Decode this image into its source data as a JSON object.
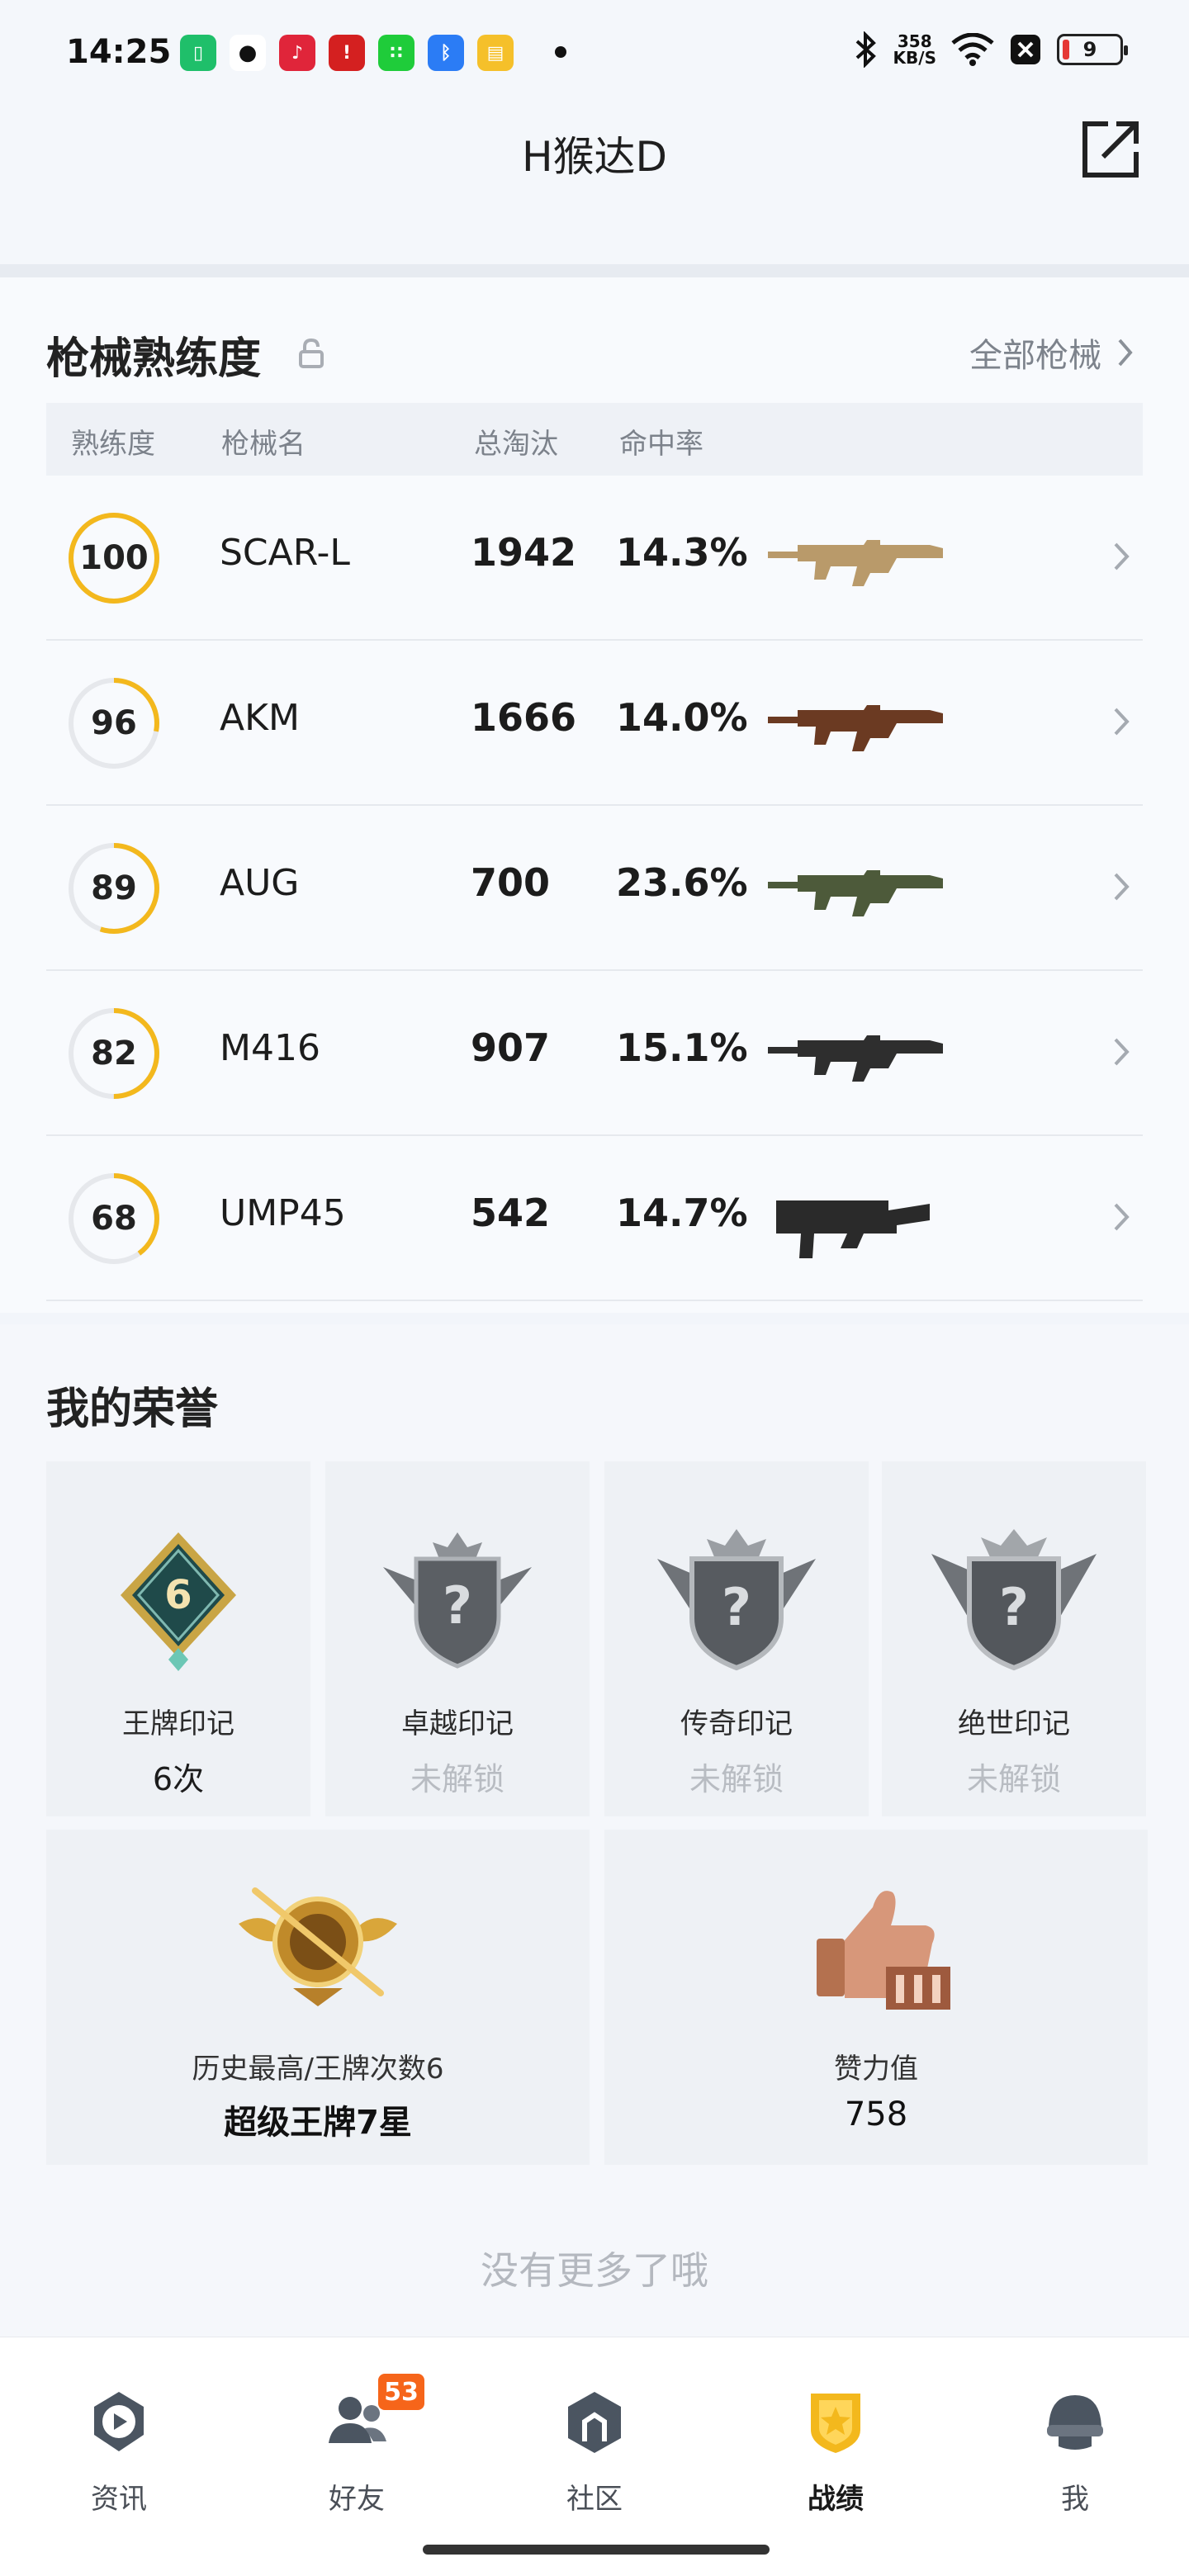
{
  "status_bar": {
    "time": "14:25",
    "net_speed_value": "358",
    "net_speed_unit": "KB/S",
    "battery": "9",
    "app_icons": [
      "sim-icon",
      "wechat-icon",
      "music-icon",
      "notification-icon",
      "app-store-icon",
      "bluetooth-app-icon",
      "notes-icon"
    ]
  },
  "header": {
    "title": "H猴达D"
  },
  "weapons": {
    "title": "枪械熟练度",
    "all_link": "全部枪械",
    "columns": [
      "熟练度",
      "枪械名",
      "总淘汰",
      "命中率"
    ],
    "rows": [
      {
        "proficiency": "100",
        "progress": 1.0,
        "name": "SCAR-L",
        "kills": "1942",
        "hit_rate": "14.3%",
        "image": "scar-l-rifle"
      },
      {
        "proficiency": "96",
        "progress": 0.28,
        "name": "AKM",
        "kills": "1666",
        "hit_rate": "14.0%",
        "image": "akm-rifle"
      },
      {
        "proficiency": "89",
        "progress": 0.55,
        "name": "AUG",
        "kills": "700",
        "hit_rate": "23.6%",
        "image": "aug-rifle"
      },
      {
        "proficiency": "82",
        "progress": 0.5,
        "name": "M416",
        "kills": "907",
        "hit_rate": "15.1%",
        "image": "m416-rifle"
      },
      {
        "proficiency": "68",
        "progress": 0.4,
        "name": "UMP45",
        "kills": "542",
        "hit_rate": "14.7%",
        "image": "ump45-smg"
      }
    ]
  },
  "honors": {
    "title": "我的荣誉",
    "badges": [
      {
        "label": "王牌印记",
        "value": "6次",
        "locked": false,
        "icon": "ace-emblem-icon",
        "number": "6"
      },
      {
        "label": "卓越印记",
        "value": "未解锁",
        "locked": true,
        "icon": "excellence-emblem-icon"
      },
      {
        "label": "传奇印记",
        "value": "未解锁",
        "locked": true,
        "icon": "legend-emblem-icon"
      },
      {
        "label": "绝世印记",
        "value": "未解锁",
        "locked": true,
        "icon": "peerless-emblem-icon"
      }
    ],
    "highest": {
      "label": "历史最高/王牌次数6",
      "value": "超级王牌7星",
      "icon": "super-ace-rank-icon"
    },
    "likes": {
      "label": "赞力值",
      "value": "758",
      "icon": "thumbs-up-trophy-icon"
    },
    "no_more": "没有更多了哦"
  },
  "nav": {
    "items": [
      {
        "label": "资讯",
        "icon": "news-play-icon",
        "active": false
      },
      {
        "label": "好友",
        "icon": "friends-icon",
        "active": false,
        "badge": "53"
      },
      {
        "label": "社区",
        "icon": "community-icon",
        "active": false
      },
      {
        "label": "战绩",
        "icon": "record-shield-icon",
        "active": true
      },
      {
        "label": "我",
        "icon": "helmet-profile-icon",
        "active": false
      }
    ]
  },
  "colors": {
    "accent_ring": "#f3b81d",
    "ring_track": "#e6e8ec",
    "nav_badge": "#f6651a",
    "locked_text": "#b8bcc2"
  }
}
